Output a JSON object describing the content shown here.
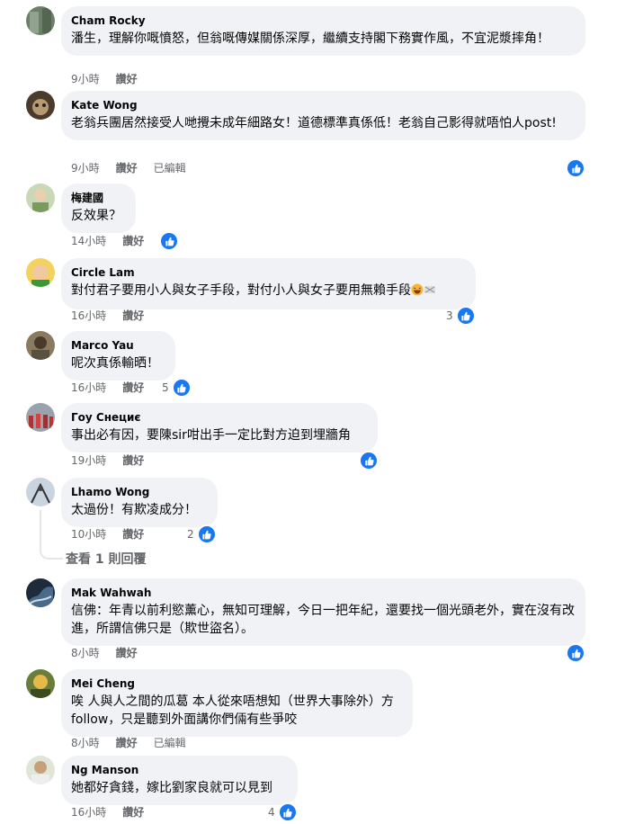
{
  "colors": {
    "accent": "#1877f2",
    "bubble": "#f0f2f5",
    "meta": "#65676b"
  },
  "comments": [
    {
      "name": "Cham Rocky",
      "text": "潘生，理解你嘅憤怒，但翁嘅傳媒關係深厚，繼續支持閣下務實作風，不宜泥漿摔角！",
      "time": "9小時",
      "like": "讚好",
      "edited": "",
      "reactions": ""
    },
    {
      "name": "Kate Wong",
      "text": "老翁兵團居然接受人哋攪未成年細路女！道德標準真係低！老翁自己影得就唔怕人post!",
      "time": "9小時",
      "like": "讚好",
      "edited": "已編輯",
      "reactions": ""
    },
    {
      "name": "梅建國",
      "text": "反效果？",
      "time": "14小時",
      "like": "讚好",
      "edited": "",
      "reactions": ""
    },
    {
      "name": "Circle Lam",
      "text": "對付君子要用小人與女子手段，對付小人與女子要用無賴手段",
      "time": "16小時",
      "like": "讚好",
      "edited": "",
      "reactions": "3"
    },
    {
      "name": "Marco Yau",
      "text": "呢次真係輸晒！",
      "time": "16小時",
      "like": "讚好",
      "edited": "",
      "reactions": "5"
    },
    {
      "name": "Гоу Снециє",
      "text": "事出必有因，要陳sir咁出手一定比對方迫到埋牆角",
      "time": "19小時",
      "like": "讚好",
      "edited": "",
      "reactions": ""
    },
    {
      "name": "Lhamo Wong",
      "text": "太過份！有欺凌成分！",
      "time": "10小時",
      "like": "讚好",
      "edited": "",
      "reactions": "2"
    },
    {
      "name": "Mak Wahwah",
      "text": "信佛：年青以前利慾薰心，無知可理解，今日一把年紀，還要找一個光頭老外，實在沒有改進，所謂信佛只是（欺世盜名）。",
      "time": "8小時",
      "like": "讚好",
      "edited": "",
      "reactions": ""
    },
    {
      "name": "Mei Cheng",
      "text": "唉 人與人之間的瓜葛 本人從來唔想知（世界大事除外）方follow，只是聽到外面講你們倆有些爭咬",
      "time": "8小時",
      "like": "讚好",
      "edited": "已編輯",
      "reactions": ""
    },
    {
      "name": "Ng Manson",
      "text": "她都好貪錢，嫁比劉家良就可以見到",
      "time": "16小時",
      "like": "讚好",
      "edited": "",
      "reactions": "4"
    }
  ],
  "view_replies": "查看 1 則回覆"
}
